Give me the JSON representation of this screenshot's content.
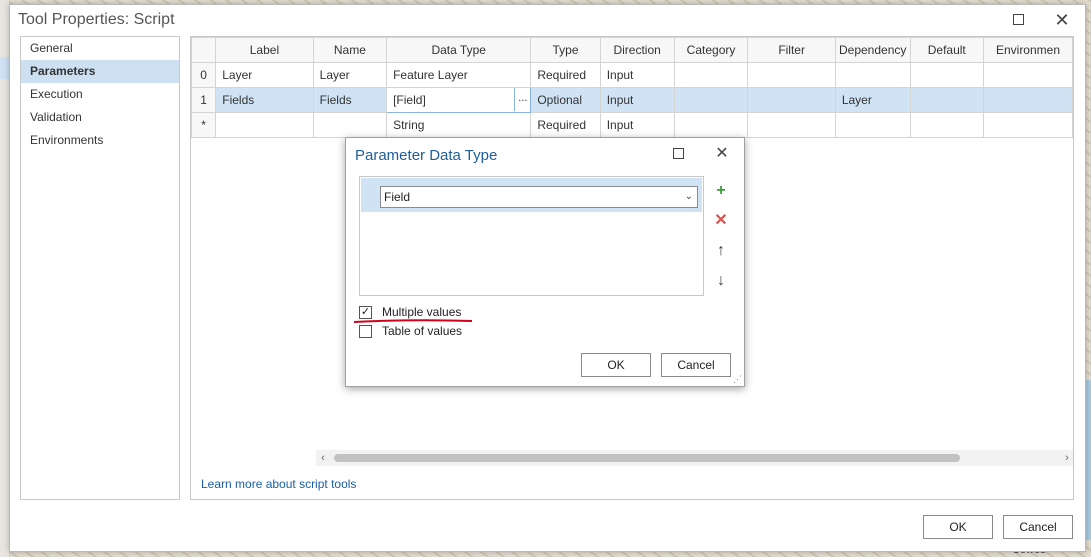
{
  "window": {
    "title": "Tool Properties: Script",
    "maximize_icon": "maximize-icon",
    "close_icon": "close-icon"
  },
  "nav": {
    "items": [
      {
        "label": "General",
        "active": false
      },
      {
        "label": "Parameters",
        "active": true
      },
      {
        "label": "Execution",
        "active": false
      },
      {
        "label": "Validation",
        "active": false
      },
      {
        "label": "Environments",
        "active": false
      }
    ]
  },
  "grid": {
    "columns": [
      "",
      "Label",
      "Name",
      "Data Type",
      "Type",
      "Direction",
      "Category",
      "Filter",
      "Dependency",
      "Default",
      "Environmen"
    ],
    "rows": [
      {
        "index": "0",
        "label": "Layer",
        "name": "Layer",
        "data_type": "Feature Layer",
        "type": "Required",
        "direction": "Input",
        "category": "",
        "filter": "",
        "dependency": "",
        "default": "",
        "environment": ""
      },
      {
        "index": "1",
        "label": "Fields",
        "name": "Fields",
        "data_type": "[Field]",
        "type": "Optional",
        "direction": "Input",
        "category": "",
        "filter": "",
        "dependency": "Layer",
        "default": "",
        "environment": ""
      },
      {
        "index": "*",
        "label": "",
        "name": "",
        "data_type": "String",
        "type": "Required",
        "direction": "Input",
        "category": "",
        "filter": "",
        "dependency": "",
        "default": "",
        "environment": ""
      }
    ],
    "selected_row": 1,
    "ellipsis": "..."
  },
  "learn_more": "Learn more about script tools",
  "buttons": {
    "ok": "OK",
    "cancel": "Cancel"
  },
  "dialog": {
    "title": "Parameter Data Type",
    "selected_type": "Field",
    "side_buttons": [
      {
        "name": "add",
        "glyph": "+",
        "color": "#3a9a3a"
      },
      {
        "name": "remove",
        "glyph": "✕",
        "color": "#d9534f"
      },
      {
        "name": "move-up",
        "glyph": "↑",
        "color": "#444444"
      },
      {
        "name": "move-down",
        "glyph": "↓",
        "color": "#444444"
      }
    ],
    "multiple_values": {
      "label": "Multiple values",
      "checked": true
    },
    "table_of_values": {
      "label": "Table of values",
      "checked": false
    },
    "ok": "OK",
    "cancel": "Cancel"
  },
  "map": {
    "labels": [
      "Cowes"
    ]
  },
  "colors": {
    "accent": "#1f5ea0",
    "selection": "#cfe3f5",
    "annotation": "#d0021b"
  }
}
